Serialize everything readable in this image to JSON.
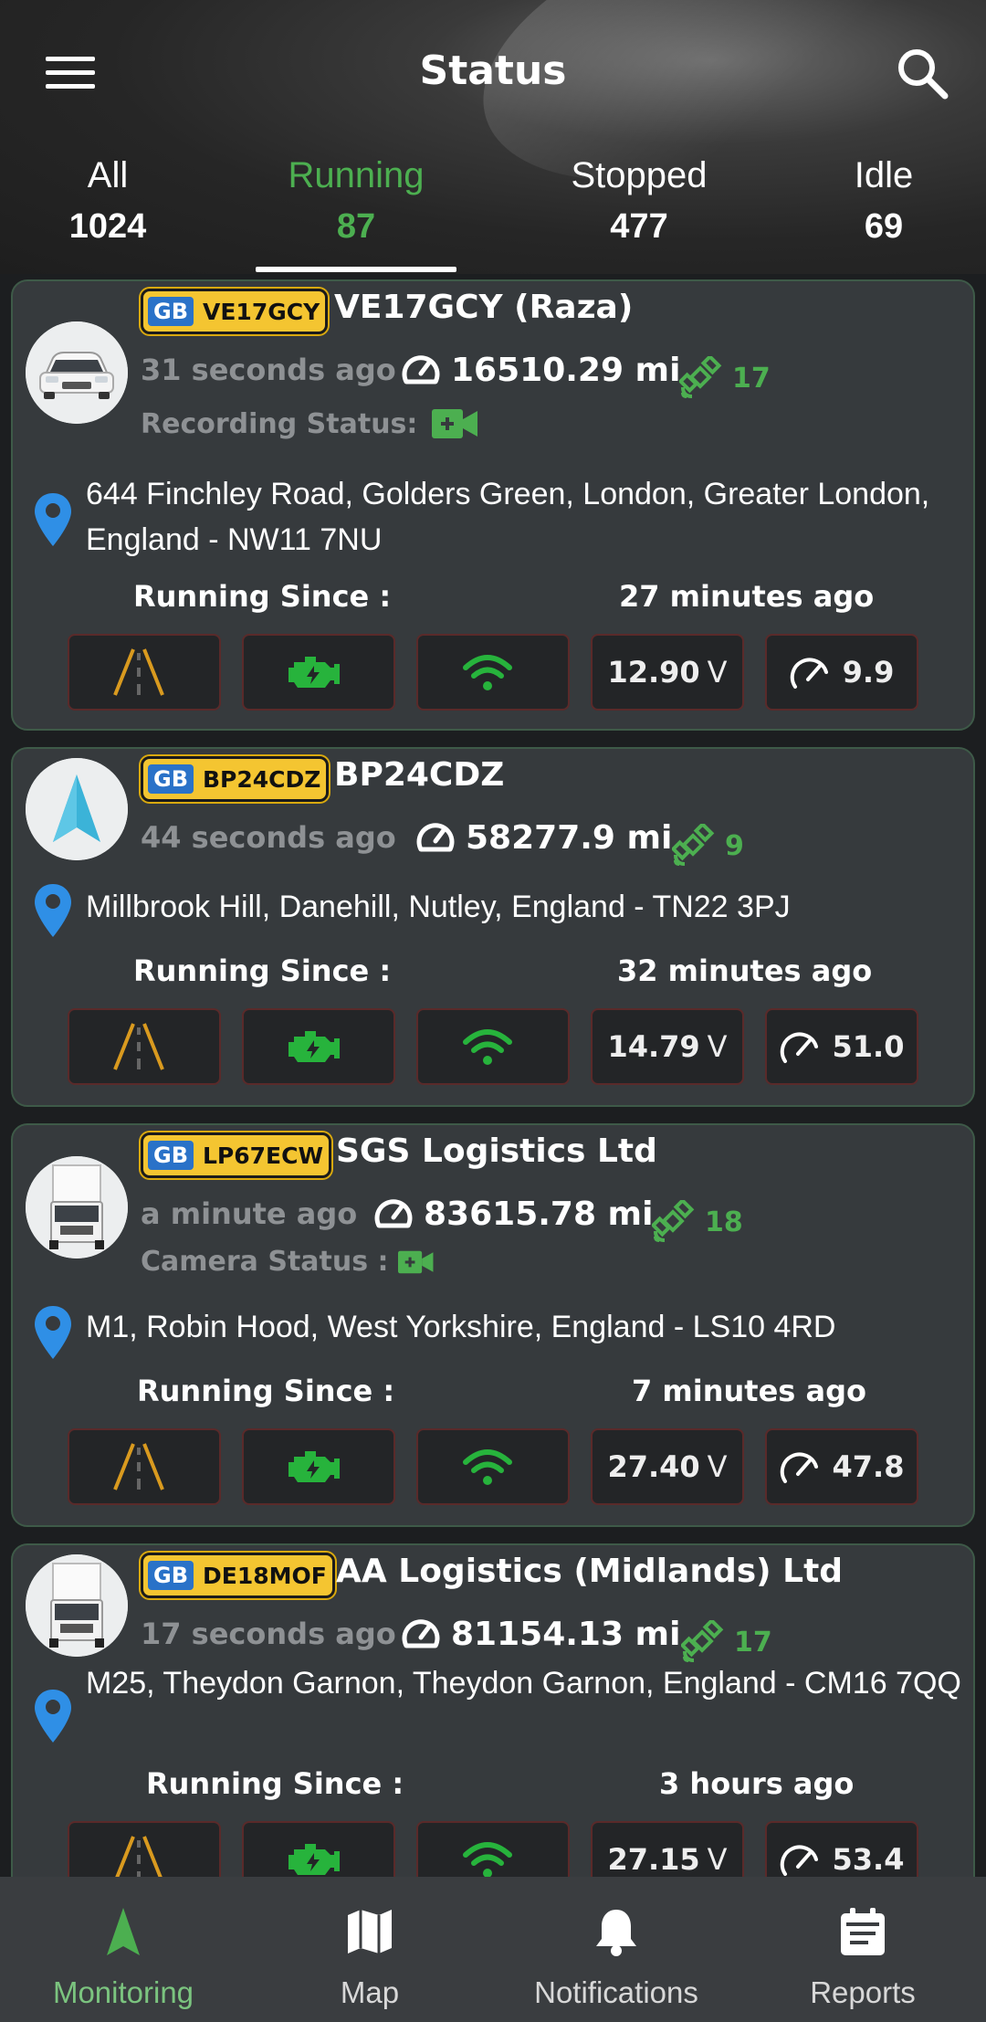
{
  "header": {
    "title": "Status"
  },
  "tabs": [
    {
      "label": "All",
      "count": "1024"
    },
    {
      "label": "Running",
      "count": "87"
    },
    {
      "label": "Stopped",
      "count": "477"
    },
    {
      "label": "Idle",
      "count": "69"
    }
  ],
  "active_tab": "Running",
  "vehicles": [
    {
      "country": "GB",
      "plate": "VE17GCY",
      "name": "VE17GCY (Raza)",
      "updated": "31 seconds ago",
      "odometer": "16510.29 mi",
      "satellites": "17",
      "status_label": "Recording Status:",
      "address": "644 Finchley Road, Golders Green, London, Greater London, England - NW11 7NU",
      "running_label": "Running Since :",
      "running_value": "27 minutes ago",
      "voltage": "12.90",
      "voltage_unit": "V",
      "speed": "9.9",
      "avatar": "car"
    },
    {
      "country": "GB",
      "plate": "BP24CDZ",
      "name": "BP24CDZ",
      "updated": "44 seconds ago",
      "odometer": "58277.9 mi",
      "satellites": "9",
      "address": "Millbrook Hill, Danehill, Nutley, England - TN22 3PJ",
      "running_label": "Running Since :",
      "running_value": "32 minutes ago",
      "voltage": "14.79",
      "voltage_unit": "V",
      "speed": "51.0",
      "avatar": "arrow"
    },
    {
      "country": "GB",
      "plate": "LP67ECW",
      "name": "SGS Logistics Ltd",
      "updated": "a minute ago",
      "odometer": "83615.78 mi",
      "satellites": "18",
      "status_label": "Camera Status :",
      "address": "M1, Robin Hood, West Yorkshire, England - LS10 4RD",
      "running_label": "Running Since :",
      "running_value": "7 minutes ago",
      "voltage": "27.40",
      "voltage_unit": "V",
      "speed": "47.8",
      "avatar": "truck"
    },
    {
      "country": "GB",
      "plate": "DE18MOF",
      "name": "AA Logistics (Midlands) Ltd",
      "updated": "17 seconds ago",
      "odometer": "81154.13 mi",
      "satellites": "17",
      "address": "M25, Theydon Garnon, Theydon Garnon, England - CM16 7QQ",
      "running_label": "Running Since :",
      "running_value": "3 hours ago",
      "voltage": "27.15",
      "voltage_unit": "V",
      "speed": "53.4",
      "avatar": "truck"
    }
  ],
  "bottom_nav": [
    {
      "label": "Monitoring",
      "icon": "navigation-arrow-icon"
    },
    {
      "label": "Map",
      "icon": "map-icon"
    },
    {
      "label": "Notifications",
      "icon": "bell-icon"
    },
    {
      "label": "Reports",
      "icon": "calendar-report-icon"
    }
  ],
  "colors": {
    "accent": "#4caf50",
    "card_bg": "#363a3d",
    "plate_yellow": "#f4c531",
    "pin_blue": "#2f8fe6"
  }
}
